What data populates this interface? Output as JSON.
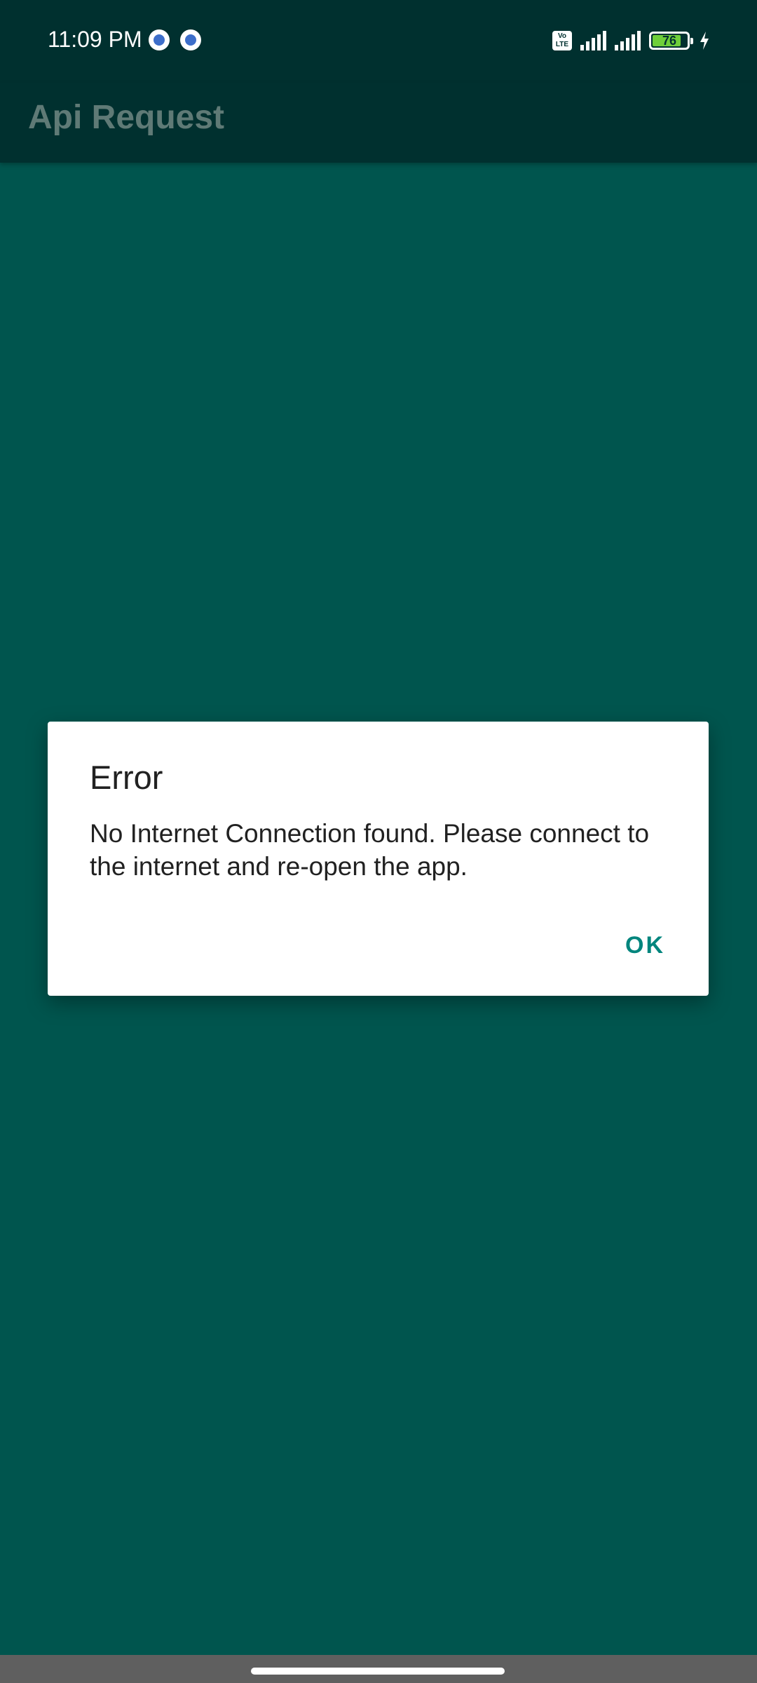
{
  "status_bar": {
    "time": "11:09 PM",
    "volte_label_top": "Vo",
    "volte_label_bottom": "LTE",
    "battery_level": "76",
    "icons": [
      "app-notification-icon",
      "app-notification-icon",
      "volte-icon",
      "signal-icon",
      "signal-icon",
      "battery-icon",
      "charging-icon"
    ]
  },
  "app_bar": {
    "title": "Api Request"
  },
  "dialog": {
    "title": "Error",
    "message": "No Internet Connection found. Please connect to the internet and re-open the app.",
    "ok_label": "OK"
  },
  "colors": {
    "background": "#00554e",
    "app_bar": "#00302f",
    "accent": "#00857d",
    "battery_fill": "#6fcf3a"
  }
}
